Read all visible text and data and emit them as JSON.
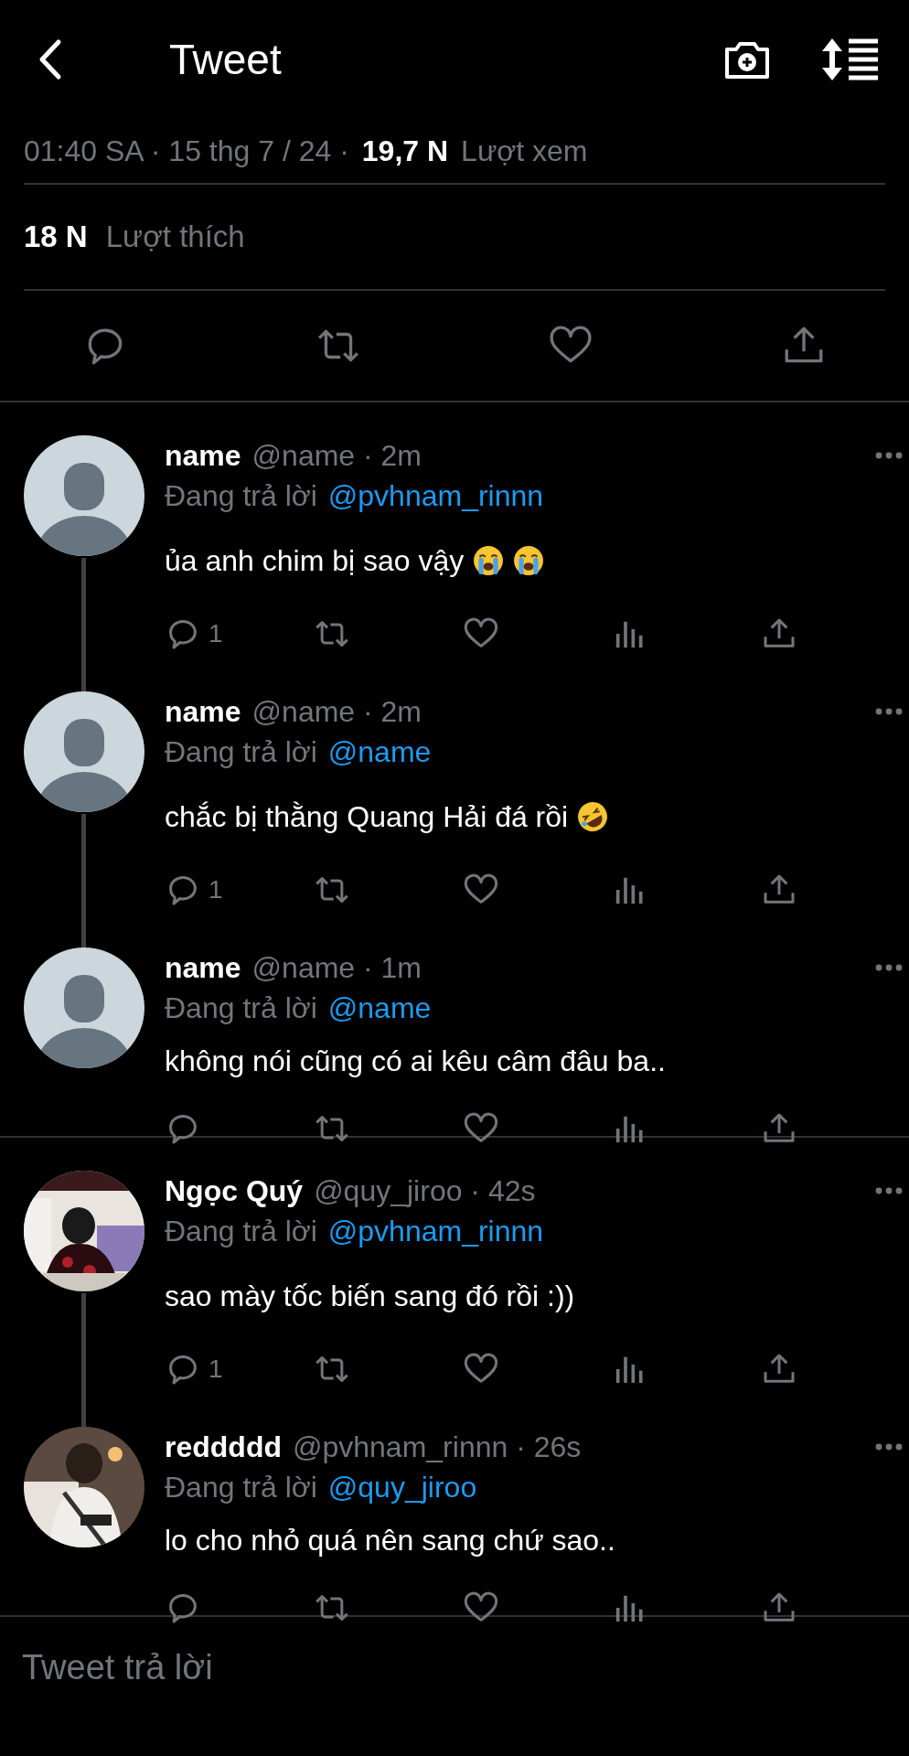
{
  "header": {
    "title": "Tweet"
  },
  "tweet_meta": {
    "time": "01:40 SA · 15 thg 7 / 24 · ",
    "views_count": "19,7 N",
    "views_label": "Lượt xem"
  },
  "likes": {
    "count": "18 N",
    "label": "Lượt thích"
  },
  "reply_threads": [
    {
      "replies": [
        {
          "name": "name",
          "handle": "@name · 2m",
          "replying_label": "Đang trả lời",
          "replying_to": "@pvhnam_rinnn",
          "text": "ủa anh chim bị sao vậy",
          "emojis": [
            {
              "kind": "crying"
            },
            {
              "kind": "crying"
            }
          ],
          "reply_count": "1",
          "avatar": {
            "kind": "default"
          },
          "thread_line": true
        },
        {
          "name": "name",
          "handle": "@name · 2m",
          "replying_label": "Đang trả lời",
          "replying_to": "@name",
          "text": "chắc bị thằng Quang Hải đá rồi",
          "emojis": [
            {
              "kind": "rofl"
            }
          ],
          "reply_count": "1",
          "avatar": {
            "kind": "default"
          },
          "thread_line": true
        },
        {
          "name": "name",
          "handle": "@name · 1m",
          "replying_label": "Đang trả lời",
          "replying_to": "@name",
          "text": "không nói cũng có ai kêu câm đâu ba..",
          "avatar": {
            "kind": "default"
          },
          "thread_line": false
        }
      ]
    },
    {
      "replies": [
        {
          "name": "Ngọc Quý",
          "handle": "@quy_jiroo · 42s",
          "replying_label": "Đang trả lời",
          "replying_to": "@pvhnam_rinnn",
          "text": "sao mày tốc biến sang đó rồi :))",
          "reply_count": "1",
          "thread_line": true
        },
        {
          "name": "reddddd",
          "handle": "@pvhnam_rinnn · 26s",
          "replying_label": "Đang trả lời",
          "replying_to": "@quy_jiroo",
          "text": "lo cho nhỏ quá nên sang chứ sao..",
          "thread_line": false
        }
      ]
    }
  ],
  "composer": {
    "placeholder": "Tweet trả lời"
  }
}
